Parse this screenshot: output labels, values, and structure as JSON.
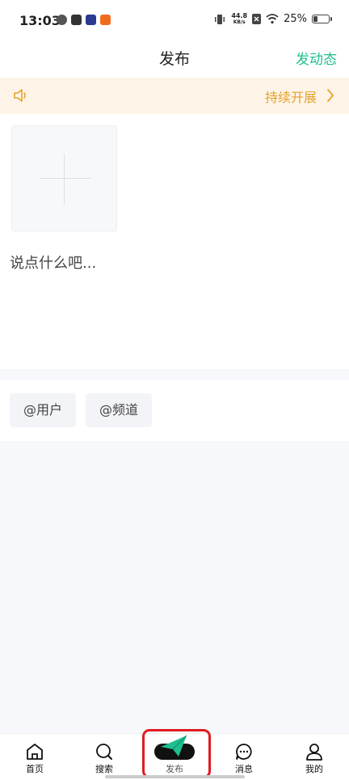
{
  "status_bar": {
    "time": "13:03",
    "net_speed_value": "44.8",
    "net_speed_unit": "KB/s",
    "battery": "25%",
    "battery_level": 0.25
  },
  "nav": {
    "title": "发布",
    "action": "发动态"
  },
  "notice": {
    "text": "持续开展"
  },
  "compose": {
    "placeholder": "说点什么吧..."
  },
  "tags": [
    {
      "label": "@用户"
    },
    {
      "label": "@频道"
    }
  ],
  "tab_bar": {
    "items": [
      {
        "label": "首页",
        "icon": "home-icon"
      },
      {
        "label": "搜索",
        "icon": "search-icon"
      },
      {
        "label": "发布",
        "icon": "publish-icon"
      },
      {
        "label": "消息",
        "icon": "message-icon"
      },
      {
        "label": "我的",
        "icon": "profile-icon"
      }
    ]
  },
  "colors": {
    "accent": "#1fbf8f",
    "notice_text": "#e6a22c",
    "notice_bg": "#fdf4e7",
    "highlight": "#e11b22"
  }
}
